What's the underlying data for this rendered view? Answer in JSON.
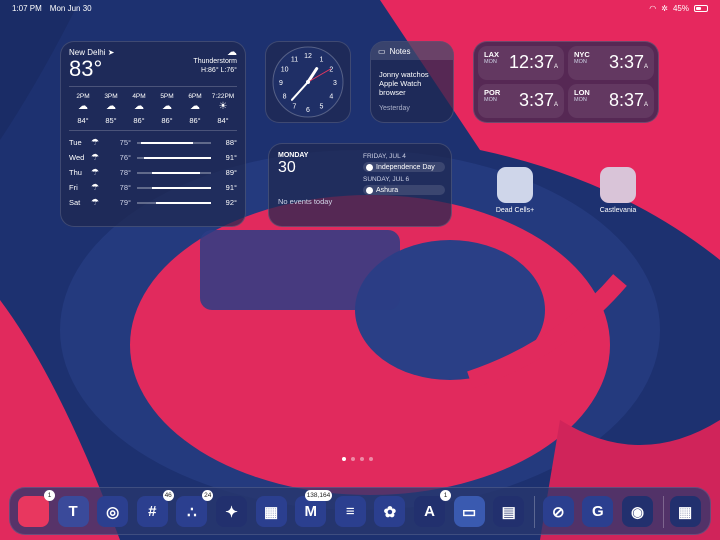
{
  "status_bar": {
    "time": "1:07 PM",
    "date": "Mon Jun 30",
    "battery": "45%",
    "battery_level": 0.45
  },
  "weather": {
    "city": "New Delhi",
    "temp": "83°",
    "condition": "Thunderstorm",
    "hilo": "H:86° L:76°",
    "hourly": [
      {
        "time": "2PM",
        "temp": "84°",
        "icon": "cloud-icon"
      },
      {
        "time": "3PM",
        "temp": "85°",
        "icon": "cloud-icon"
      },
      {
        "time": "4PM",
        "temp": "86°",
        "icon": "cloud-icon"
      },
      {
        "time": "5PM",
        "temp": "86°",
        "icon": "cloud-icon"
      },
      {
        "time": "6PM",
        "temp": "86°",
        "icon": "cloud-icon"
      },
      {
        "time": "7:22PM",
        "temp": "84°",
        "icon": "sunset-icon"
      }
    ],
    "daily": [
      {
        "day": "Tue",
        "low": "75°",
        "high": "88°",
        "icon": "rain-cloud-icon",
        "bar_start": 0.05,
        "bar_end": 0.75
      },
      {
        "day": "Wed",
        "low": "76°",
        "high": "91°",
        "icon": "rain-cloud-icon",
        "bar_start": 0.1,
        "bar_end": 1.0
      },
      {
        "day": "Thu",
        "low": "78°",
        "high": "89°",
        "icon": "rain-cloud-icon",
        "bar_start": 0.2,
        "bar_end": 0.85
      },
      {
        "day": "Fri",
        "low": "78°",
        "high": "91°",
        "icon": "rain-cloud-icon",
        "bar_start": 0.2,
        "bar_end": 1.0
      },
      {
        "day": "Sat",
        "low": "79°",
        "high": "92°",
        "icon": "rain-cloud-icon",
        "bar_start": 0.25,
        "bar_end": 1.0
      }
    ]
  },
  "clock": {
    "numerals": [
      "12",
      "1",
      "2",
      "3",
      "4",
      "5",
      "6",
      "7",
      "8",
      "9",
      "10",
      "11"
    ]
  },
  "notes": {
    "title": "Notes",
    "text": "Jonny watchos Apple Watch browser",
    "date": "Yesterday"
  },
  "world_clock": [
    {
      "city": "LAX",
      "day": "MON",
      "time": "12:37",
      "ampm": "A"
    },
    {
      "city": "NYC",
      "day": "MON",
      "time": "3:37",
      "ampm": "A"
    },
    {
      "city": "POR",
      "day": "MON",
      "time": "3:37",
      "ampm": "A"
    },
    {
      "city": "LON",
      "day": "MON",
      "time": "8:37",
      "ampm": "A"
    }
  ],
  "calendar": {
    "weekday": "MONDAY",
    "date": "30",
    "no_events": "No events today",
    "upcoming": [
      {
        "header": "FRIDAY, JUL 4",
        "event": "Independence Day"
      },
      {
        "header": "SUNDAY, JUL 6",
        "event": "Ashura"
      }
    ]
  },
  "home_apps": [
    {
      "label": "Dead Cells+",
      "color": "#cfd6ea"
    },
    {
      "label": "Castlevania",
      "color": "#d9c4d8"
    }
  ],
  "dock": [
    {
      "name": "messages",
      "badge": "1",
      "glyph": "",
      "bg": "#e8375f"
    },
    {
      "name": "teams",
      "badge": "",
      "glyph": "T",
      "bg": "#3a4a9a"
    },
    {
      "name": "chrome",
      "badge": "",
      "glyph": "◎",
      "bg": "#2b3f8f"
    },
    {
      "name": "slack",
      "badge": "46",
      "glyph": "#",
      "bg": "#2b3f8f"
    },
    {
      "name": "asana",
      "badge": "24",
      "glyph": "∴",
      "bg": "#2b3f8f"
    },
    {
      "name": "gemini",
      "badge": "",
      "glyph": "✦",
      "bg": "#22306e"
    },
    {
      "name": "sheets",
      "badge": "",
      "glyph": "▦",
      "bg": "#2b3f8f"
    },
    {
      "name": "gmail",
      "badge": "138,164",
      "glyph": "M",
      "bg": "#2b3f8f"
    },
    {
      "name": "docs",
      "badge": "",
      "glyph": "≡",
      "bg": "#2b3f8f"
    },
    {
      "name": "photos",
      "badge": "",
      "glyph": "✿",
      "bg": "#2b3f8f"
    },
    {
      "name": "app-store",
      "badge": "1",
      "glyph": "A",
      "bg": "#22306e"
    },
    {
      "name": "files",
      "badge": "",
      "glyph": "▭",
      "bg": "#3a5ab0"
    },
    {
      "name": "wallet",
      "badge": "",
      "glyph": "▤",
      "bg": "#22306e"
    },
    {
      "name": "safari",
      "badge": "",
      "glyph": "⊘",
      "bg": "#2b3f8f"
    },
    {
      "name": "grammarly",
      "badge": "",
      "glyph": "G",
      "bg": "#2b3f8f"
    },
    {
      "name": "compressor",
      "badge": "",
      "glyph": "◉",
      "bg": "#22306e"
    },
    {
      "name": "app-library",
      "badge": "",
      "glyph": "▦",
      "bg": "#22306e"
    }
  ]
}
